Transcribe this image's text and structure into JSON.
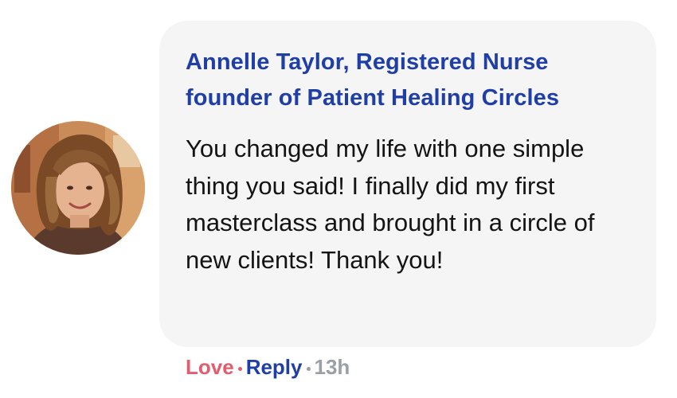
{
  "comment": {
    "author": {
      "name_line_1": "Annelle Taylor, Registered Nurse",
      "name_line_2": "founder of Patient Healing Circles",
      "avatar": "profile-photo"
    },
    "text": "You changed my life with one simple thing you said! I finally did my first masterclass and brought in a circle of new clients! Thank you!",
    "actions": {
      "love_label": "Love",
      "reply_label": "Reply",
      "timestamp": "13h"
    }
  },
  "colors": {
    "author_name": "#1f3fa6",
    "love": "#e25d6d",
    "reply": "#1f3fa6",
    "timestamp": "#9aa0a6",
    "bubble_background": "#f5f5f6",
    "comment_text": "#141414"
  }
}
